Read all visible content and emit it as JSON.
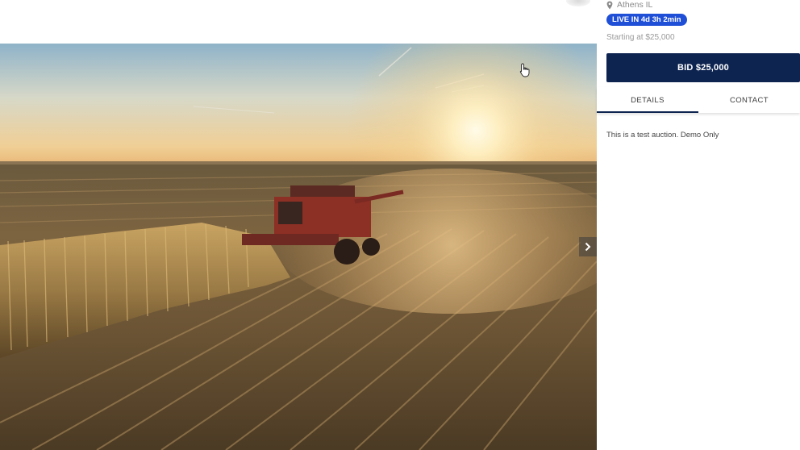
{
  "listing": {
    "location": "Athens IL",
    "location_icon": "map-pin-icon",
    "live_badge": "LIVE IN 4d 3h 2min",
    "starting_at": "Starting at $25,000",
    "bid_label": "BID $25,000"
  },
  "tabs": [
    {
      "label": "DETAILS",
      "active": true
    },
    {
      "label": "CONTACT",
      "active": false
    }
  ],
  "details": {
    "text": "This is a test auction. Demo Only"
  },
  "gallery": {
    "next_icon": "chevron-right-icon"
  },
  "colors": {
    "accent": "#1f4fd6",
    "bid_button": "#0e2450",
    "muted_text": "#8a8a8a"
  }
}
